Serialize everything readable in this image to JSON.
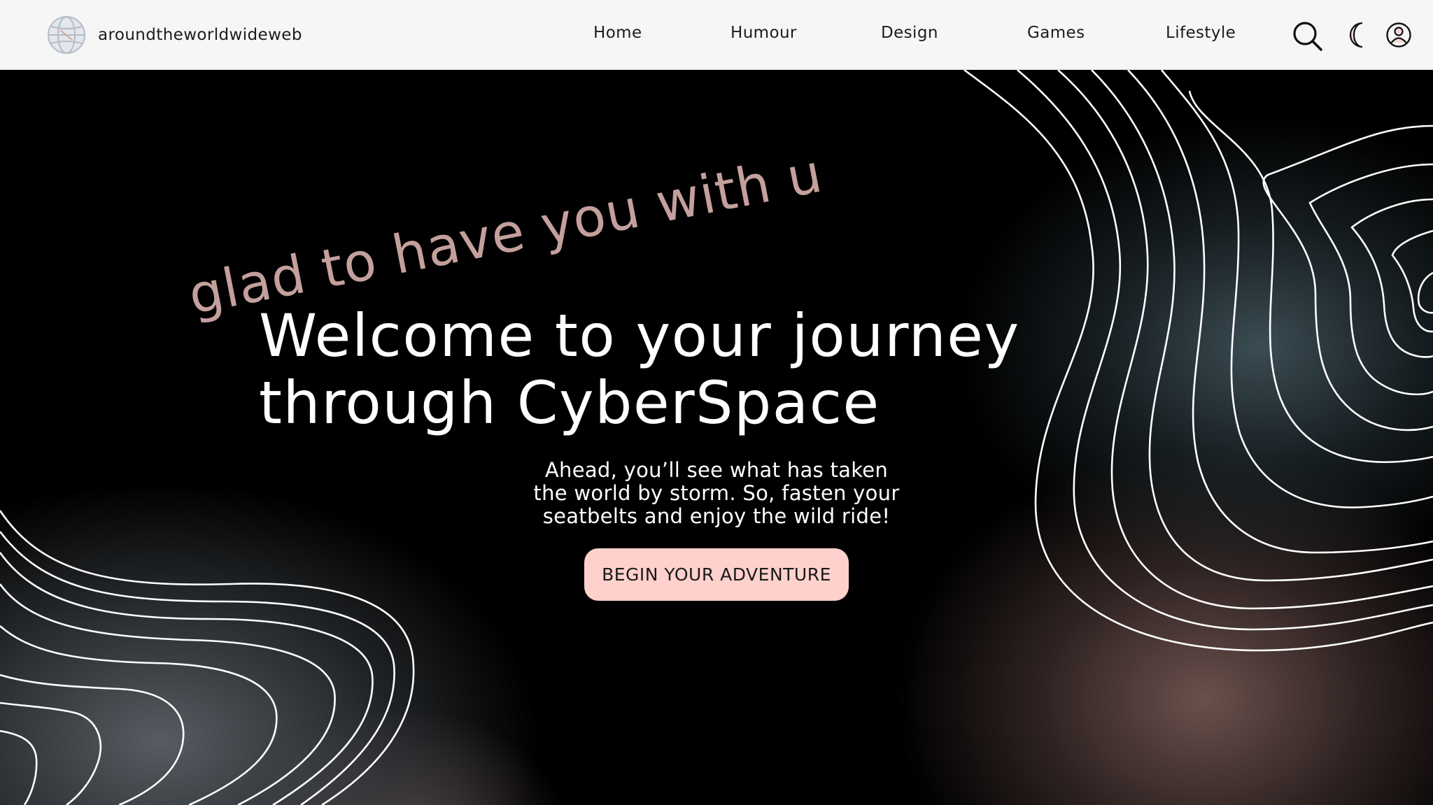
{
  "brand": {
    "name": "aroundtheworldwideweb",
    "logo_icon": "globe-icon"
  },
  "nav": {
    "items": [
      {
        "label": "Home"
      },
      {
        "label": "Humour"
      },
      {
        "label": "Design"
      },
      {
        "label": "Games"
      },
      {
        "label": "Lifestyle"
      }
    ],
    "icons": [
      "search-icon",
      "moon-icon",
      "user-icon"
    ]
  },
  "hero": {
    "tagline": "glad to have you with us",
    "title": "Welcome to your journey\nthrough CyberSpace",
    "description": "Ahead, you’ll see what has taken\nthe world by storm. So, fasten your\nseatbelts and enjoy the wild ride!",
    "cta_label": "BEGIN YOUR ADVENTURE"
  },
  "colors": {
    "header_bg": "#f6f6f6",
    "hero_bg": "#000000",
    "accent_pink": "#ffd1cc",
    "tagline_color": "#c4a09c",
    "text_light": "#ffffff"
  }
}
